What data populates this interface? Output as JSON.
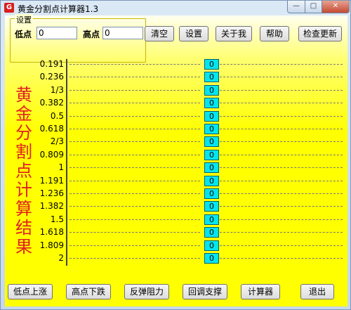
{
  "window": {
    "title": "黄金分割点计算器1.3",
    "app_icon_glyph": "G",
    "minimize_glyph": "—",
    "maximize_glyph": "□",
    "close_glyph": "✕"
  },
  "settings": {
    "legend": "设置",
    "low_label": "低点",
    "low_value": "0",
    "high_label": "高点",
    "high_value": "0"
  },
  "top_buttons": {
    "clear": "清空",
    "set": "设置",
    "about": "关于我",
    "help": "帮助",
    "update": "检查更新"
  },
  "result_title": [
    "黄",
    "金",
    "分",
    "割",
    "点",
    "计",
    "算",
    "结",
    "果"
  ],
  "ratios": [
    {
      "label": "0.191",
      "value": "0"
    },
    {
      "label": "0.236",
      "value": "0"
    },
    {
      "label": "1/3",
      "value": "0"
    },
    {
      "label": "0.382",
      "value": "0"
    },
    {
      "label": "0.5",
      "value": "0"
    },
    {
      "label": "0.618",
      "value": "0"
    },
    {
      "label": "2/3",
      "value": "0"
    },
    {
      "label": "0.809",
      "value": "0"
    },
    {
      "label": "1",
      "value": "0"
    },
    {
      "label": "1.191",
      "value": "0"
    },
    {
      "label": "1.236",
      "value": "0"
    },
    {
      "label": "1.382",
      "value": "0"
    },
    {
      "label": "1.5",
      "value": "0"
    },
    {
      "label": "1.618",
      "value": "0"
    },
    {
      "label": "1.809",
      "value": "0"
    },
    {
      "label": "2",
      "value": "0"
    }
  ],
  "bottom_buttons": {
    "low_rise": "低点上涨",
    "high_fall": "高点下跌",
    "rebound_resistance": "反弹阻力",
    "pullback_support": "回调支撑",
    "calculator": "计算器",
    "exit": "退出"
  },
  "colors": {
    "background": "#ffff00",
    "value_box": "#00e5f0",
    "result_title": "#e02020"
  }
}
